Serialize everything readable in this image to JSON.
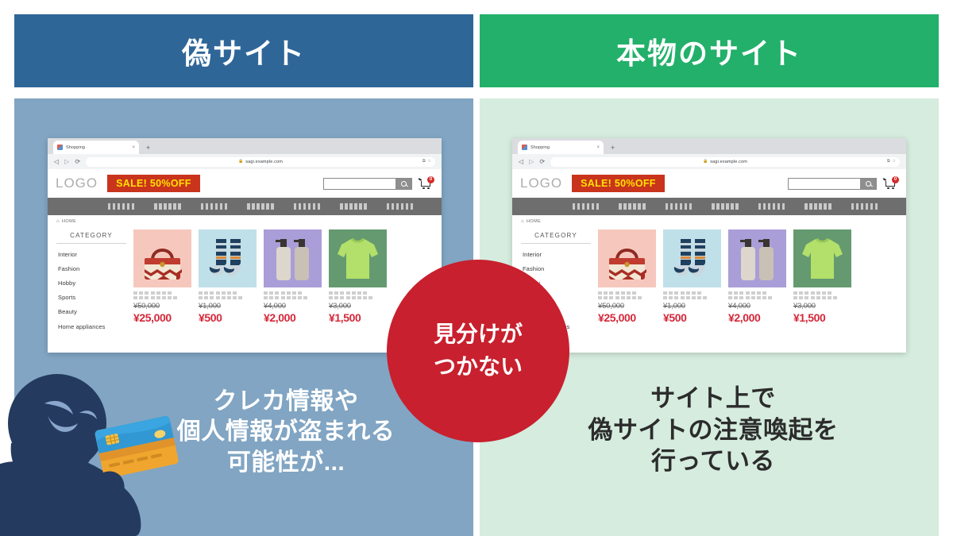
{
  "headers": {
    "fake": {
      "label": "偽サイト",
      "color": "#2f6698"
    },
    "real": {
      "label": "本物のサイト",
      "color": "#22b06a"
    }
  },
  "badge": {
    "line1": "見分けが",
    "line2": "つかない",
    "color": "#c8202e"
  },
  "captions": {
    "fake": {
      "line1": "クレカ情報や",
      "line2": "個人情報が盗まれる",
      "line3": "可能性が..."
    },
    "real": {
      "line1": "サイト上で",
      "line2": "偽サイトの注意喚起を",
      "line3": "行っている"
    }
  },
  "browser": {
    "tab_title": "Shopping",
    "tab_close": "×",
    "new_tab": "+",
    "back": "◁",
    "forward": "▷",
    "reload": "⟳",
    "lock_icon": "🔒",
    "url": "sagi.example.com",
    "omni_bookmark": "☆",
    "omni_extension": "⧉"
  },
  "site": {
    "logo": "LOGO",
    "sale_label": "SALE! 50%OFF",
    "sale_bg": "#c9341d",
    "sale_fg": "#ffe300",
    "search_placeholder": "",
    "search_value": "",
    "cart_count": "0",
    "breadcrumb_home_icon": "⌂",
    "breadcrumb": "HOME",
    "nav_item_count": 7,
    "category_title": "CATEGORY",
    "categories": [
      "Interior",
      "Fashion",
      "Hobby",
      "Sports",
      "Beauty",
      "Home appliances"
    ],
    "products": [
      {
        "name": "bag",
        "thumb_class": "t-bag",
        "old_price": "¥50,000",
        "new_price": "¥25,000"
      },
      {
        "name": "socks",
        "thumb_class": "t-socks",
        "old_price": "¥1,000",
        "new_price": "¥500"
      },
      {
        "name": "bottle",
        "thumb_class": "t-bottle",
        "old_price": "¥4,000",
        "new_price": "¥2,000"
      },
      {
        "name": "shirt",
        "thumb_class": "t-shirt",
        "old_price": "¥3,000",
        "new_price": "¥1,500"
      }
    ]
  },
  "panels": {
    "fake_bg": "#81a5c3",
    "real_bg": "#d5ecde"
  }
}
